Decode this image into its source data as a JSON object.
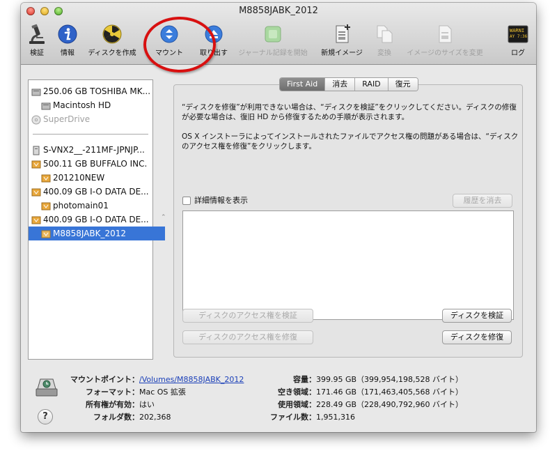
{
  "window": {
    "title": "M8858JABK_2012"
  },
  "toolbar": {
    "verify": "検証",
    "info": "情報",
    "burn": "ディスクを作成",
    "mount": "マウント",
    "eject": "取り出す",
    "journal": "ジャーナル記録を開始",
    "new_image": "新規イメージ",
    "convert": "変換",
    "resize": "イメージのサイズを変更",
    "log": "ログ",
    "log_icon_text": [
      "WARNI",
      "AY 7:36"
    ]
  },
  "sidebar": {
    "items": [
      {
        "label": "250.06 GB TOSHIBA MK..."
      },
      {
        "label": "Macintosh HD"
      },
      {
        "label": "SuperDrive"
      },
      {
        "label": "S-VNX2__-211MF-JPNJP..."
      },
      {
        "label": "500.11 GB BUFFALO INC."
      },
      {
        "label": "201210NEW"
      },
      {
        "label": "400.09 GB I-O DATA DE..."
      },
      {
        "label": "photomain01"
      },
      {
        "label": "400.09 GB I-O DATA DE..."
      },
      {
        "label": "M8858JABK_2012"
      }
    ]
  },
  "tabs": [
    "First Aid",
    "消去",
    "RAID",
    "復元"
  ],
  "firstaid": {
    "desc1": "“ディスクを修復”が利用できない場合は、“ディスクを検証”をクリックしてください。ディスクの修復が必要な場合は、復旧 HD から修復するための手順が表示されます。",
    "desc2": "OS X インストーラによってインストールされたファイルでアクセス権の問題がある場合は、“ディスクのアクセス権を修復”をクリックします。",
    "show_details": "詳細情報を表示",
    "clear_history": "履歴を消去",
    "verify_permissions": "ディスクのアクセス権を検証",
    "repair_permissions": "ディスクのアクセス権を修復",
    "verify_disk": "ディスクを検証",
    "repair_disk": "ディスクを修復"
  },
  "info": {
    "mount_point_label": "マウントポイント：",
    "mount_point_value": "/Volumes/M8858JABK_2012",
    "format_label": "フォーマット：",
    "format_value": "Mac OS 拡張",
    "owners_label": "所有権が有効：",
    "owners_value": "はい",
    "folders_label": "フォルダ数：",
    "folders_value": "202,368",
    "capacity_label": "容量：",
    "capacity_value": "399.95 GB（399,954,198,528 バイト）",
    "available_label": "空き領域：",
    "available_value": "171.46 GB（171,463,405,568 バイト）",
    "used_label": "使用領域：",
    "used_value": "228.49 GB（228,490,792,960 バイト）",
    "files_label": "ファイル数：",
    "files_value": "1,951,316"
  },
  "help": "?"
}
